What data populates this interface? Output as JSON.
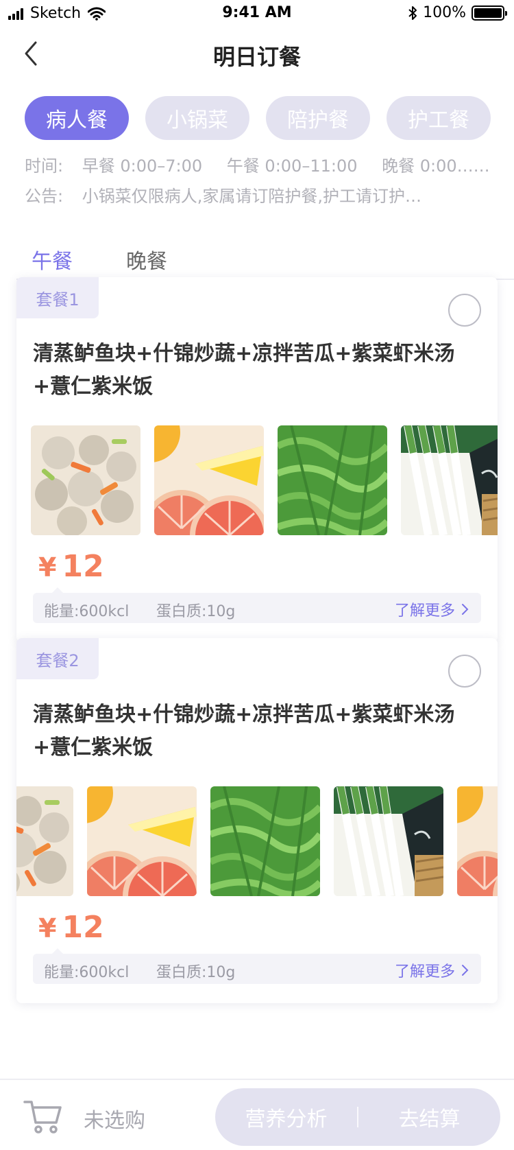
{
  "status_bar": {
    "carrier": "Sketch",
    "time": "9:41 AM",
    "battery": "100%"
  },
  "nav": {
    "title": "明日订餐"
  },
  "meal_types": [
    {
      "label": "病人餐",
      "active": true
    },
    {
      "label": "小锅菜",
      "active": false
    },
    {
      "label": "陪护餐",
      "active": false
    },
    {
      "label": "护工餐",
      "active": false
    }
  ],
  "info": {
    "time_label": "时间:",
    "time_segments": [
      "早餐  0:00–7:00",
      "午餐  0:00–11:00",
      "晚餐  0:00…"
    ],
    "notice_label": "公告:",
    "notice_text": "小锅菜仅限病人,家属请订陪护餐,护工请订护…"
  },
  "tabs": [
    {
      "label": "午餐",
      "active": true
    },
    {
      "label": "晚餐",
      "active": false
    }
  ],
  "cards": [
    {
      "tag": "套餐1",
      "title": "清蒸鲈鱼块+什锦炒蔬+凉拌苦瓜+紫菜虾米汤+薏仁紫米饭",
      "currency": "¥",
      "price": "12",
      "energy": "能量:600kcl",
      "protein": "蛋白质:10g",
      "more": "了解更多",
      "photos": [
        "meatballs",
        "grapefruit",
        "arugula",
        "scallions"
      ]
    },
    {
      "tag": "套餐2",
      "title": "清蒸鲈鱼块+什锦炒蔬+凉拌苦瓜+紫菜虾米汤+薏仁紫米饭",
      "currency": "¥",
      "price": "12",
      "energy": "能量:600kcl",
      "protein": "蛋白质:10g",
      "more": "了解更多",
      "photos": [
        "meatballs",
        "grapefruit",
        "arugula",
        "scallions",
        "grapefruit"
      ]
    }
  ],
  "bottom": {
    "cart_status": "未选购",
    "nutrition_analysis": "营养分析",
    "checkout": "去结算"
  },
  "colors": {
    "accent": "#7a73e8",
    "price": "#f4815f",
    "chip_inactive": "#e3e2f0"
  }
}
